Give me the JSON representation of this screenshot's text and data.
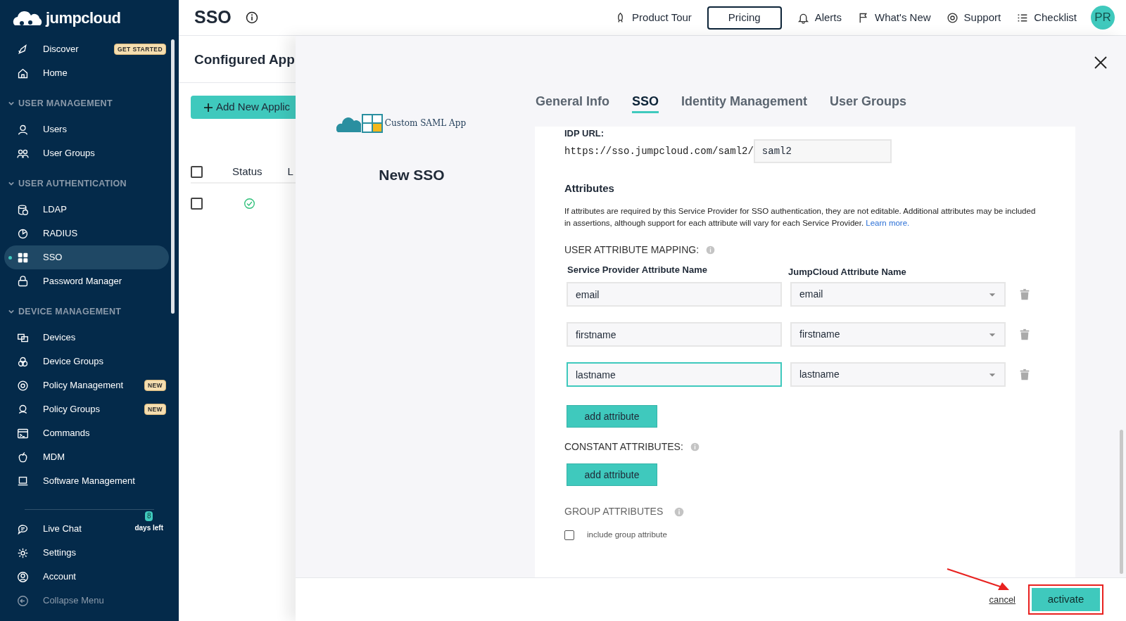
{
  "sidebar": {
    "logo": "jumpcloud",
    "sections": [
      {
        "kind": "plain",
        "items": [
          {
            "label": "Discover",
            "badge": "GET STARTED",
            "selected": false
          },
          {
            "label": "Home",
            "selected": false
          }
        ]
      },
      {
        "kind": "group",
        "title": "USER MANAGEMENT",
        "expanded": true,
        "items": [
          {
            "label": "Users",
            "selected": false
          },
          {
            "label": "User Groups",
            "selected": false
          }
        ]
      },
      {
        "kind": "group",
        "title": "USER AUTHENTICATION",
        "expanded": true,
        "items": [
          {
            "label": "LDAP",
            "selected": false
          },
          {
            "label": "RADIUS",
            "selected": false
          },
          {
            "label": "SSO",
            "selected": true
          },
          {
            "label": "Password Manager",
            "selected": false
          }
        ]
      },
      {
        "kind": "group",
        "title": "DEVICE MANAGEMENT",
        "expanded": true,
        "items": [
          {
            "label": "Devices",
            "selected": false
          },
          {
            "label": "Device Groups",
            "selected": false
          },
          {
            "label": "Policy Management",
            "badge": "NEW",
            "selected": false
          },
          {
            "label": "Policy Groups",
            "badge": "NEW",
            "selected": false
          },
          {
            "label": "Commands",
            "selected": false
          },
          {
            "label": "MDM",
            "selected": false
          },
          {
            "label": "Software Management",
            "selected": false
          }
        ]
      }
    ],
    "bottom_items": [
      {
        "label": "Live Chat",
        "count": "8",
        "count_caption": "days left"
      },
      {
        "label": "Settings"
      },
      {
        "label": "Account"
      },
      {
        "label": "Collapse Menu",
        "muted": true
      }
    ]
  },
  "topbar": {
    "title": "SSO",
    "links": [
      {
        "kind": "link",
        "label": "Product Tour"
      },
      {
        "kind": "button",
        "label": "Pricing"
      },
      {
        "kind": "link",
        "label": "Alerts"
      },
      {
        "kind": "link",
        "label": "What's New"
      },
      {
        "kind": "link",
        "label": "Support"
      },
      {
        "kind": "link",
        "label": "Checklist"
      }
    ],
    "avatar": "PR"
  },
  "background_page": {
    "heading": "Configured App",
    "add_button": "Add New Applic",
    "select_all_checked": false,
    "columns": [
      "Status",
      "L"
    ],
    "rows": [
      {
        "checked": false,
        "active": true
      }
    ]
  },
  "modal": {
    "app_name": "Custom SAML App",
    "title": "New SSO",
    "tabs": [
      {
        "label": "General Info",
        "selected": false
      },
      {
        "label": "SSO",
        "selected": true
      },
      {
        "label": "Identity Management",
        "selected": false
      },
      {
        "label": "User Groups",
        "selected": false
      }
    ],
    "idp_url": {
      "label": "IDP URL:",
      "prefix": "https://sso.jumpcloud.com/saml2/",
      "value": "saml2"
    },
    "attributes": {
      "heading": "Attributes",
      "description": "If attributes are required by this Service Provider for SSO authentication, they are not editable. Additional attributes may be included in assertions, although support for each attribute will vary for each Service Provider.",
      "link": "Learn more.",
      "user_mapping": {
        "label": "USER ATTRIBUTE MAPPING:",
        "columns": [
          "Service Provider Attribute Name",
          "JumpCloud Attribute Name"
        ],
        "rows": [
          {
            "name": "email",
            "value": "email",
            "focused": false
          },
          {
            "name": "firstname",
            "value": "firstname",
            "focused": false
          },
          {
            "name": "lastname",
            "value": "lastname",
            "focused": true
          }
        ],
        "add_button": "add attribute"
      },
      "constant": {
        "label": "CONSTANT ATTRIBUTES:",
        "add_button": "add attribute"
      },
      "group": {
        "label": "GROUP ATTRIBUTES",
        "checkbox_label": "include group attribute",
        "checked": false
      }
    },
    "footer": {
      "cancel": "cancel",
      "activate": "activate",
      "activate_highlighted": true
    }
  }
}
